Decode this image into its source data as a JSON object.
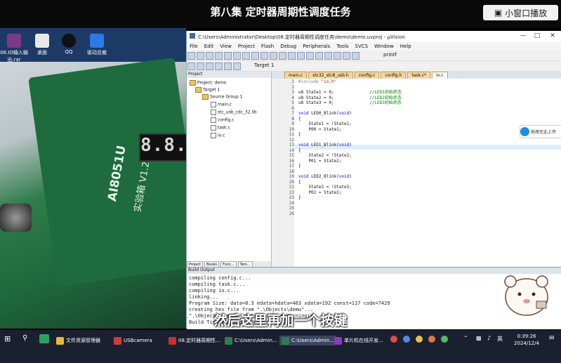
{
  "video": {
    "title": "第八集 定时器周期性调度任务",
    "mini_window_button": "小窗口播放",
    "subtitle": "然后这里再加一个按键"
  },
  "desktop_icons": [
    {
      "label": "06.IO输入输出.rar"
    },
    {
      "label": "桌面"
    },
    {
      "label": "QQ"
    },
    {
      "label": "驱动总裁"
    }
  ],
  "board": {
    "seven_segment": "8.8.8",
    "silkscreen_model": "AI8051U",
    "silkscreen_text": "实验箱 V1.2"
  },
  "uvision": {
    "window_title": "C:\\Users\\Administrator\\Desktop\\08.定时器周期性调度任务\\demo\\demo.uvproj - µVision",
    "menu": [
      "File",
      "Edit",
      "View",
      "Project",
      "Flash",
      "Debug",
      "Peripherals",
      "Tools",
      "SVCS",
      "Window",
      "Help"
    ],
    "target": "Target 1",
    "printf_field": "printf",
    "project_panel": {
      "header": "Project",
      "items": [
        "Project: demo",
        "Target 1",
        "Source Group 1",
        "main.c",
        "stc_usb_cdc_32.lib",
        "config.c",
        "task.c",
        "io.c"
      ],
      "tabs": [
        "Project",
        "Books",
        "Func...",
        "Tem..."
      ]
    },
    "editor_tabs": [
      "main.c",
      "stc32_stc8_usb.h",
      "config.c",
      "config.h",
      "task.c*",
      "io.c"
    ],
    "code": [
      {
        "n": "1",
        "t": "#include \"io.h\""
      },
      {
        "n": "2",
        "t": ""
      },
      {
        "n": "3",
        "t": "u8 State1 = 0;              //LED1初始状态"
      },
      {
        "n": "4",
        "t": "u8 State2 = 0;              //LED2初始状态"
      },
      {
        "n": "5",
        "t": "u8 State3 = 0;              //LED3初始状态"
      },
      {
        "n": "6",
        "t": ""
      },
      {
        "n": "7",
        "t": "void LED0_Blink(void)"
      },
      {
        "n": "8",
        "t": "{"
      },
      {
        "n": "9",
        "t": "    State1 = !State1;"
      },
      {
        "n": "10",
        "t": "    P00 = State1;"
      },
      {
        "n": "11",
        "t": "}"
      },
      {
        "n": "12",
        "t": ""
      },
      {
        "n": "13",
        "t": "void LED1_Blink(void)"
      },
      {
        "n": "14",
        "t": "{"
      },
      {
        "n": "15",
        "t": "    State2 = !State2;"
      },
      {
        "n": "16",
        "t": "    P01 = State2;"
      },
      {
        "n": "17",
        "t": "}"
      },
      {
        "n": "18",
        "t": ""
      },
      {
        "n": "19",
        "t": "void LED2_Blink(void)"
      },
      {
        "n": "20",
        "t": "{"
      },
      {
        "n": "21",
        "t": "    State3 = !State3;"
      },
      {
        "n": "22",
        "t": "    P02 = State3;"
      },
      {
        "n": "23",
        "t": "}"
      },
      {
        "n": "24",
        "t": ""
      },
      {
        "n": "25",
        "t": ""
      },
      {
        "n": "26",
        "t": ""
      }
    ],
    "build_output": {
      "header": "Build Output",
      "lines": [
        "compiling config.c...",
        "compiling task.c...",
        "compiling io.c...",
        "linking...",
        "Program Size: data=8.3 edata+hdata=463 xdata=192 const=117 code=7429",
        "creating hex file from \".\\Objects\\demo\"...",
        "\".\\Objects\\demo\" - 0 Error(s), 0 Warning(s).",
        "Build Time Elapsed:  00:00:01"
      ]
    }
  },
  "cloud_popup": "拖拽至此上传",
  "taskbar": {
    "items": [
      "文件资源管理器",
      "USBcamera",
      "08.定时器周期性...",
      "C:\\Users\\Admin...",
      "C:\\Users\\Admin...",
      "单片机在线开发..."
    ],
    "clock_time": "0:39:26",
    "clock_date": "2024/12/4",
    "tray_text": "英"
  },
  "colors": {
    "keyword": "#0000ff",
    "comment": "#008000",
    "tab_bg": "#f4d7a0",
    "taskbar": "#1b2030"
  }
}
